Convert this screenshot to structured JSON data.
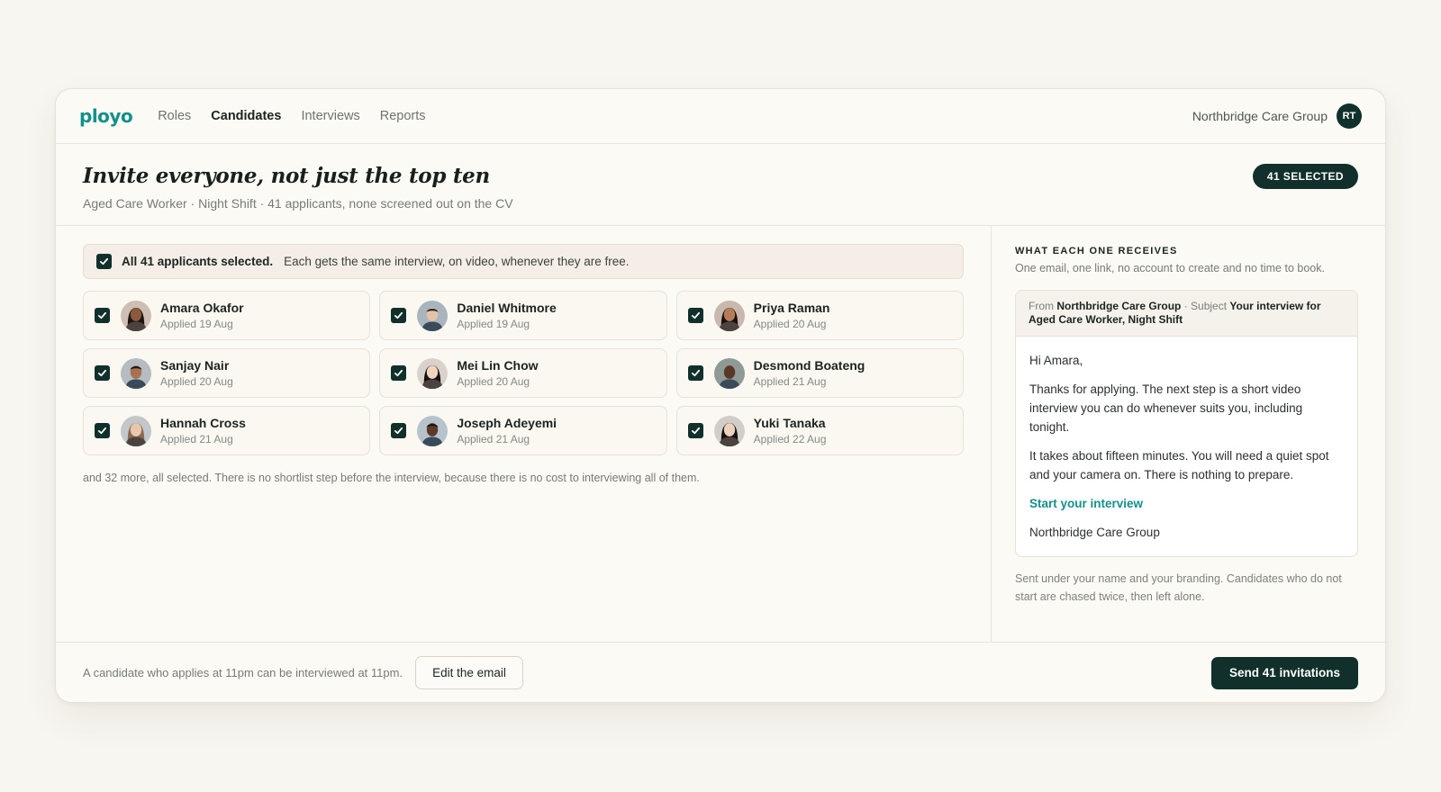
{
  "nav": {
    "logo": "ployo",
    "items": [
      {
        "label": "Roles",
        "active": false
      },
      {
        "label": "Candidates",
        "active": true
      },
      {
        "label": "Interviews",
        "active": false
      },
      {
        "label": "Reports",
        "active": false
      }
    ],
    "org": "Northbridge Care Group",
    "avatar_initials": "RT"
  },
  "header": {
    "title": "Invite everyone, not just the top ten",
    "subtitle": "Aged Care Worker · Night Shift · 41 applicants, none screened out on the CV",
    "badge": "41 SELECTED"
  },
  "selection": {
    "all_label": "All 41 applicants selected.",
    "all_desc": "Each gets the same interview, on video, whenever they are free."
  },
  "candidates": [
    {
      "name": "Amara Okafor",
      "applied": "Applied 19 Aug",
      "avatar": "woman-dark-hair-icon"
    },
    {
      "name": "Daniel Whitmore",
      "applied": "Applied 19 Aug",
      "avatar": "man-short-hair-icon"
    },
    {
      "name": "Priya Raman",
      "applied": "Applied 20 Aug",
      "avatar": "woman-long-hair-icon"
    },
    {
      "name": "Sanjay Nair",
      "applied": "Applied 20 Aug",
      "avatar": "man-beard-icon"
    },
    {
      "name": "Mei Lin Chow",
      "applied": "Applied 20 Aug",
      "avatar": "woman-long-hair-icon"
    },
    {
      "name": "Desmond Boateng",
      "applied": "Applied 21 Aug",
      "avatar": "man-bald-icon"
    },
    {
      "name": "Hannah Cross",
      "applied": "Applied 21 Aug",
      "avatar": "woman-short-hair-icon"
    },
    {
      "name": "Joseph Adeyemi",
      "applied": "Applied 21 Aug",
      "avatar": "man-smiling-icon"
    },
    {
      "name": "Yuki Tanaka",
      "applied": "Applied 22 Aug",
      "avatar": "woman-dark-hair-icon"
    }
  ],
  "more_note": "and 32 more, all selected. There is no shortlist step before the interview, because there is no cost to interviewing all of them.",
  "panel": {
    "label": "WHAT EACH ONE RECEIVES",
    "desc": "One email, one link, no account to create and no time to book.",
    "email": {
      "from_prefix": "From",
      "from": "Northbridge Care Group",
      "subject_prefix": "· Subject",
      "subject": "Your interview for Aged Care Worker, Night Shift",
      "greeting": "Hi Amara,",
      "para1": "Thanks for applying. The next step is a short video interview you can do whenever suits you, including tonight.",
      "para2": "It takes about fifteen minutes. You will need a quiet spot and your camera on. There is nothing to prepare.",
      "link": "Start your interview",
      "signature": "Northbridge Care Group"
    },
    "footnote": "Sent under your name and your branding. Candidates who do not start are chased twice, then left alone."
  },
  "footer": {
    "note": "A candidate who applies at 11pm can be interviewed at 11pm.",
    "edit_label": "Edit the email",
    "send_label": "Send 41 invitations"
  },
  "colors": {
    "brand": "#13908a",
    "dark": "#11302b",
    "background": "#f8f6f0"
  }
}
